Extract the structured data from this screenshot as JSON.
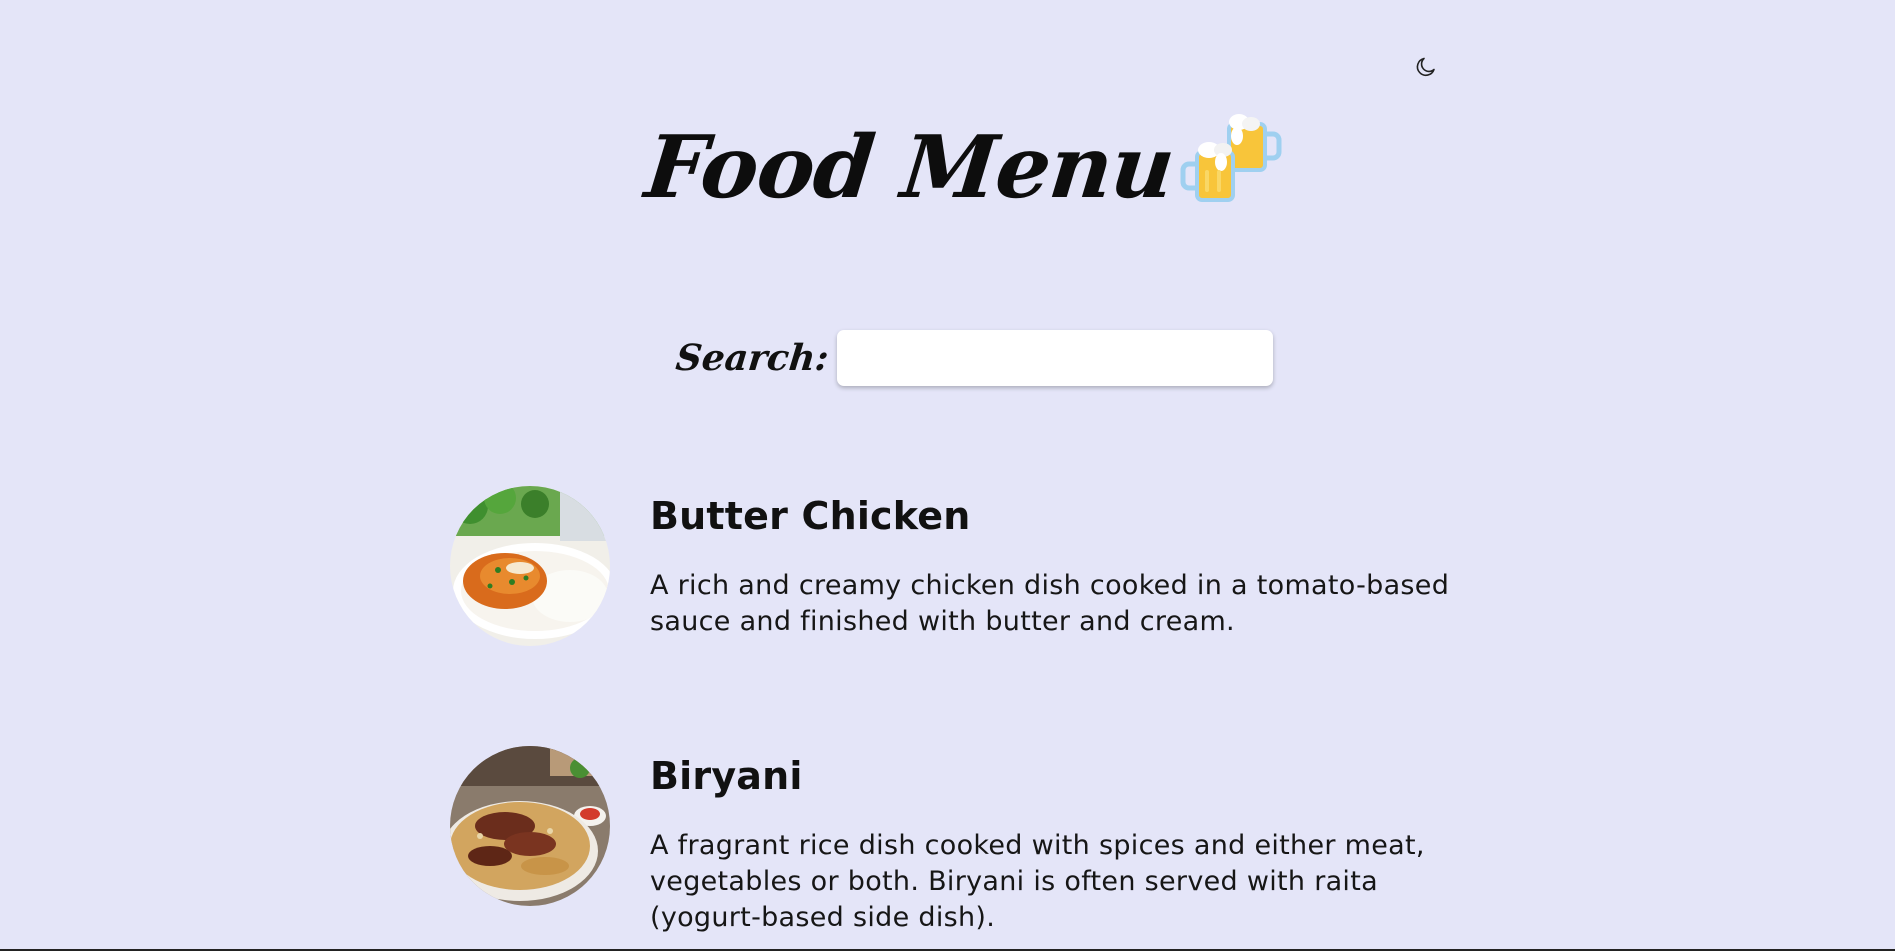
{
  "header": {
    "title": "Food Menu",
    "title_icon": "beer-mugs-icon",
    "theme_toggle_icon": "moon-icon"
  },
  "search": {
    "label": "Search:",
    "value": "",
    "placeholder": ""
  },
  "menu": {
    "items": [
      {
        "name": "Butter Chicken",
        "description": "A rich and creamy chicken dish cooked in a tomato-based sauce and finished with butter and cream.",
        "image": "butter-chicken-image"
      },
      {
        "name": "Biryani",
        "description": "A fragrant rice dish cooked with spices and either meat, vegetables or both. Biryani is often served with raita (yogurt-based side dish).",
        "image": "biryani-image"
      }
    ]
  },
  "colors": {
    "background": "#e4e5f8",
    "text": "#111111",
    "input_background": "#ffffff"
  }
}
